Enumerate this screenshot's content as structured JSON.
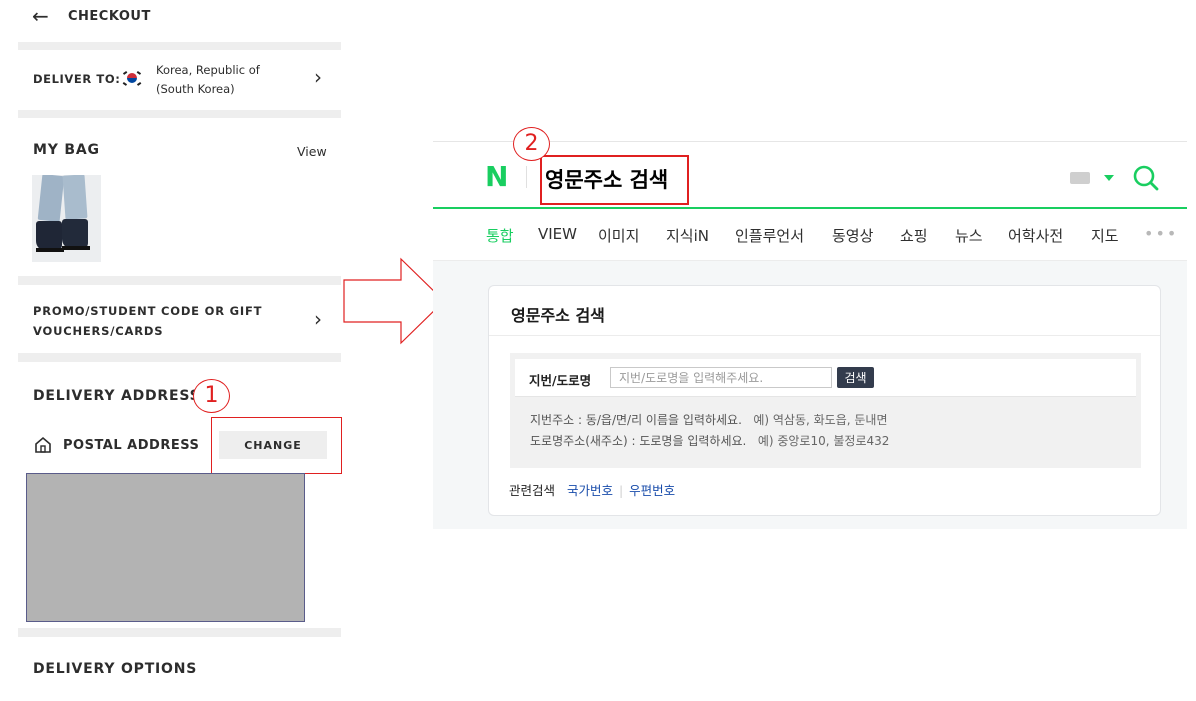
{
  "checkout": {
    "back_icon": "arrow-left-icon",
    "title": "CHECKOUT",
    "deliver_to": {
      "label": "DELIVER TO:",
      "flag_icon": "korea-flag-icon",
      "country": "Korea, Republic of (South Korea)"
    },
    "my_bag": {
      "title": "MY BAG",
      "view_label": "View"
    },
    "promo": {
      "label": "PROMO/STUDENT CODE OR GIFT VOUCHERS/CARDS"
    },
    "delivery_address": {
      "title": "DELIVERY ADDRESS",
      "postal_label": "POSTAL ADDRESS",
      "change_label": "CHANGE",
      "home_icon": "house-icon"
    },
    "delivery_options": {
      "title": "DELIVERY OPTIONS"
    }
  },
  "annotations": {
    "step1": "1",
    "step2": "2",
    "accent": "#e02020"
  },
  "naver": {
    "logo": "N",
    "query": "영문주소 검색",
    "brand_color": "#19ce60",
    "tabs": [
      "통합",
      "VIEW",
      "이미지",
      "지식iN",
      "인플루언서",
      "동영상",
      "쇼핑",
      "뉴스",
      "어학사전",
      "지도"
    ],
    "more_label": "•••",
    "card": {
      "title": "영문주소 검색",
      "field_label": "지번/도로명",
      "placeholder": "지번/도로명을 입력해주세요.",
      "search_button": "검색",
      "hint1": "지번주소 : 동/읍/면/리 이름을 입력하세요.",
      "hint1_example": "예) 역삼동, 화도읍, 둔내면",
      "hint2": "도로명주소(새주소) : 도로명을 입력하세요.",
      "hint2_example": "예) 중앙로10, 불정로432"
    },
    "related": {
      "label": "관련검색",
      "links": [
        "국가번호",
        "우편번호"
      ]
    }
  }
}
